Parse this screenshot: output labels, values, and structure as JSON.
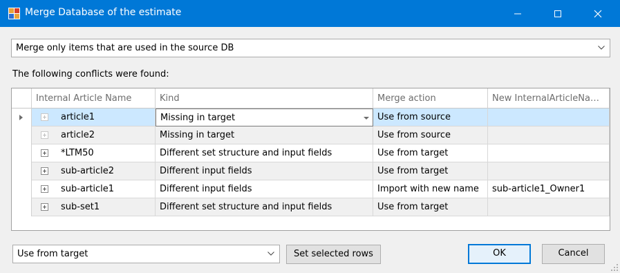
{
  "window": {
    "title": "Merge Database of the estimate",
    "icon": "app-grid-icon",
    "controls": [
      "minimize-icon",
      "maximize-icon",
      "close-icon"
    ]
  },
  "mode_select": {
    "value": "Merge only items that are used in the source DB"
  },
  "conflicts_label": "The following conflicts were found:",
  "grid": {
    "columns": [
      "Internal Article Name",
      "Kind",
      "Merge action",
      "New InternalArticleNa…"
    ],
    "rows": [
      {
        "name": "article1",
        "kind": "Missing in target",
        "merge": "Use from source",
        "new_name": ""
      },
      {
        "name": "article2",
        "kind": "Missing in target",
        "merge": "Use from source",
        "new_name": ""
      },
      {
        "name": "*LTM50",
        "kind": "Different set structure and input fields",
        "merge": "Use from target",
        "new_name": ""
      },
      {
        "name": "sub-article2",
        "kind": "Different input fields",
        "merge": "Use from target",
        "new_name": ""
      },
      {
        "name": "sub-article1",
        "kind": "Different input fields",
        "merge": "Import with new name",
        "new_name": "sub-article1_Owner1"
      },
      {
        "name": "sub-set1",
        "kind": "Different set structure and input fields",
        "merge": "Use from target",
        "new_name": ""
      }
    ]
  },
  "footer": {
    "action_select": "Use from target",
    "set_rows_label": "Set selected rows",
    "ok_label": "OK",
    "cancel_label": "Cancel"
  },
  "colors": {
    "titlebar": "#0078d7",
    "selection": "#cce8ff",
    "alt_row": "#f0f0f0"
  }
}
